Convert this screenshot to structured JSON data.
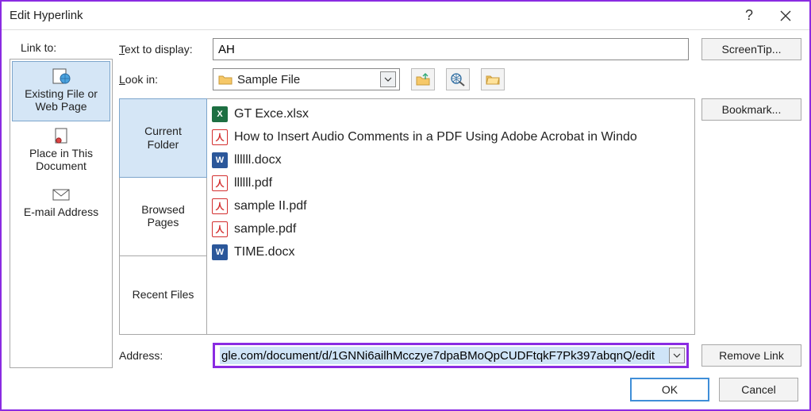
{
  "window": {
    "title": "Edit Hyperlink"
  },
  "labels": {
    "link_to": "Link to:",
    "text_to_display": "Text to display:",
    "look_in": "Look in:",
    "address": "Address:"
  },
  "text_to_display_value": "AH",
  "buttons": {
    "screentip": "ScreenTip...",
    "bookmark": "Bookmark...",
    "remove_link": "Remove Link",
    "ok": "OK",
    "cancel": "Cancel"
  },
  "link_to_items": [
    {
      "label": "Existing File or\nWeb Page",
      "icon": "globe-file-icon",
      "selected": true
    },
    {
      "label": "Place in This\nDocument",
      "icon": "doc-place-icon",
      "selected": false
    },
    {
      "label": "E-mail Address",
      "icon": "email-icon",
      "selected": false
    }
  ],
  "look_in": {
    "selected": "Sample File"
  },
  "folder_tabs": [
    {
      "label": "Current\nFolder",
      "selected": true
    },
    {
      "label": "Browsed\nPages",
      "selected": false
    },
    {
      "label": "Recent Files",
      "selected": false
    }
  ],
  "files": [
    {
      "name": "GT Exce.xlsx",
      "type": "xlsx"
    },
    {
      "name": "How to Insert Audio Comments in a PDF Using Adobe Acrobat in Windo",
      "type": "pdf"
    },
    {
      "name": "llllll.docx",
      "type": "docx"
    },
    {
      "name": "llllll.pdf",
      "type": "pdf"
    },
    {
      "name": "sample II.pdf",
      "type": "pdf"
    },
    {
      "name": "sample.pdf",
      "type": "pdf"
    },
    {
      "name": "TIME.docx",
      "type": "docx"
    }
  ],
  "address_value": "gle.com/document/d/1GNNi6ailhMcczye7dpaBMoQpCUDFtqkF7Pk397abqnQ/edit"
}
